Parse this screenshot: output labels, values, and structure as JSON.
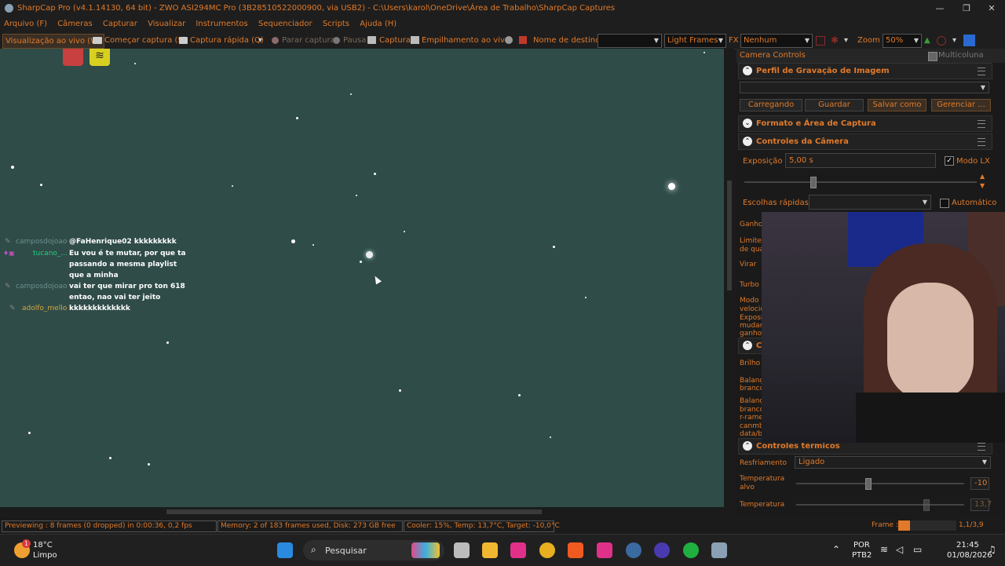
{
  "window": {
    "title": "SharpCap Pro (v4.1.14130, 64 bit) - ZWO ASI294MC Pro (3B28510522000900, via USB2) - C:\\Users\\karol\\OneDrive\\Área de Trabalho\\SharpCap Captures",
    "minimize": "—",
    "maximize": "❐",
    "close": "✕"
  },
  "menu": [
    "Arquivo (F)",
    "Câmeras",
    "Capturar",
    "Visualizar",
    "Instrumentos",
    "Sequenciador",
    "Scripts",
    "Ajuda (H)"
  ],
  "toolbar": {
    "live_view": "Visualização ao vivo (W)",
    "start_capture": "Começar captura (S)",
    "quick_capture": "Captura rápida (Q)",
    "stop_capture": "Parar captura",
    "pause": "Pausa",
    "snapshot": "Captura",
    "live_stack": "Empilhamento ao vivo",
    "target_name": "Nome de destino",
    "target_value": "",
    "frame_type": "Light Frames",
    "fx_label": "FX",
    "fx_value": "Nenhum",
    "zoom_label": "Zoom",
    "zoom_value": "50%"
  },
  "chat": [
    {
      "user": "camposdojoao",
      "msg": "@FaHenrique02 kkkkkkkkk",
      "color": "#6c8f8d"
    },
    {
      "user": "tucano_...",
      "msg": "Eu vou é te mutar, por que ta passando a mesma playlist que a minha",
      "color": "#22d07a"
    },
    {
      "user": "camposdojoao",
      "msg": "vai ter que mirar pro ton 618 entao, nao vai ter jeito",
      "color": "#6c8f8d"
    },
    {
      "user": "adolfo_mello",
      "msg": "kkkkkkkkkkkkk",
      "color": "#d4a640"
    }
  ],
  "panel": {
    "header": "Camera Controls",
    "multicolumn": "Multicoluna",
    "sections": {
      "profile": "Perfil de Gravação de Imagem",
      "format": "Formato e Área de Captura",
      "camera": "Controles da Câmera",
      "thermal": "Controles térmicos"
    },
    "profile_buttons": [
      "Carregando",
      "Guardar",
      "Salvar como ...",
      "Gerenciar ..."
    ],
    "exposure_label": "Exposição",
    "exposure_value": "5,00 s",
    "lx_mode": "Modo LX",
    "quick_choices": "Escolhas rápidas",
    "automatic": "Automático",
    "partial_labels": [
      "Ganho",
      "Limite",
      "de qua",
      "Virar",
      "Turbo",
      "Modo c",
      "velocid",
      "Exposi",
      "mudan",
      "ganho",
      "Brilho",
      "Balanç",
      "branco",
      "Balanç",
      "branco",
      "r-rame",
      "canmb",
      "data/b"
    ],
    "color_section_partial": "C",
    "cooling_label": "Resfriamento",
    "cooling_value": "Ligado",
    "target_temp_label": "Temperatura alvo",
    "target_temp_value": "-10",
    "temp_label": "Temperatura",
    "temp_value": "13,7"
  },
  "status": {
    "preview": "Previewing : 8 frames (0 dropped) in 0:00:36, 0,2 fps",
    "memory": "Memory: 2 of 183 frames used, Disk: 273 GB free",
    "cooler": "Cooler: 15%, Temp: 13,7°C, Target: -10,0°C",
    "frame_label": "Frame :",
    "frame_value": "1,1/3,9"
  },
  "taskbar": {
    "weather_temp": "18°C",
    "weather_desc": "Limpo",
    "weather_badge": "1",
    "search": "Pesquisar",
    "lang1": "POR",
    "lang2": "PTB2",
    "time": "21:45",
    "date": "01/08/2026"
  },
  "colors": {
    "accent": "#e07a2a",
    "sky": "#2f4c49",
    "bg": "#1b1b1b"
  }
}
